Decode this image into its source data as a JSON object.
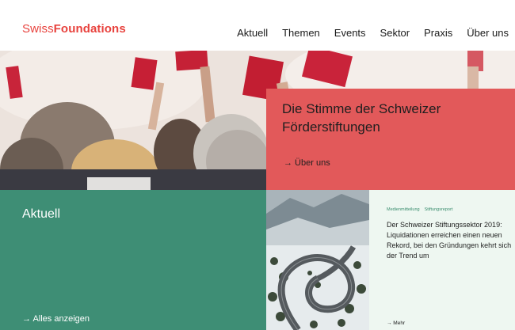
{
  "header": {
    "logo_light": "Swiss",
    "logo_bold": "Foundations",
    "nav": [
      {
        "label": "Aktuell"
      },
      {
        "label": "Themen"
      },
      {
        "label": "Events"
      },
      {
        "label": "Sektor"
      },
      {
        "label": "Praxis"
      },
      {
        "label": "Über uns"
      }
    ]
  },
  "hero": {
    "title": "Die Stimme der Schweizer Förderstiftungen",
    "link": "→ Über uns"
  },
  "aktuell": {
    "title": "Aktuell",
    "link": "→ Alles anzeigen"
  },
  "news": {
    "tags": [
      "Medienmitteilung",
      "Stiftungsreport"
    ],
    "headline": "Der Schweizer Stiftungssektor 2019: Liquidationen erreichen einen neuen Rekord, bei den Gründungen kehrt sich der Trend um",
    "more": "→ Mehr"
  },
  "colors": {
    "brand_red": "#e8423d",
    "hero_card": "#e2595a",
    "aktuell_green": "#3e8e75",
    "news_bg": "#eef7f1",
    "tag_green": "#3a8d6e"
  },
  "icons": {
    "arrow": "arrow-right-icon"
  }
}
